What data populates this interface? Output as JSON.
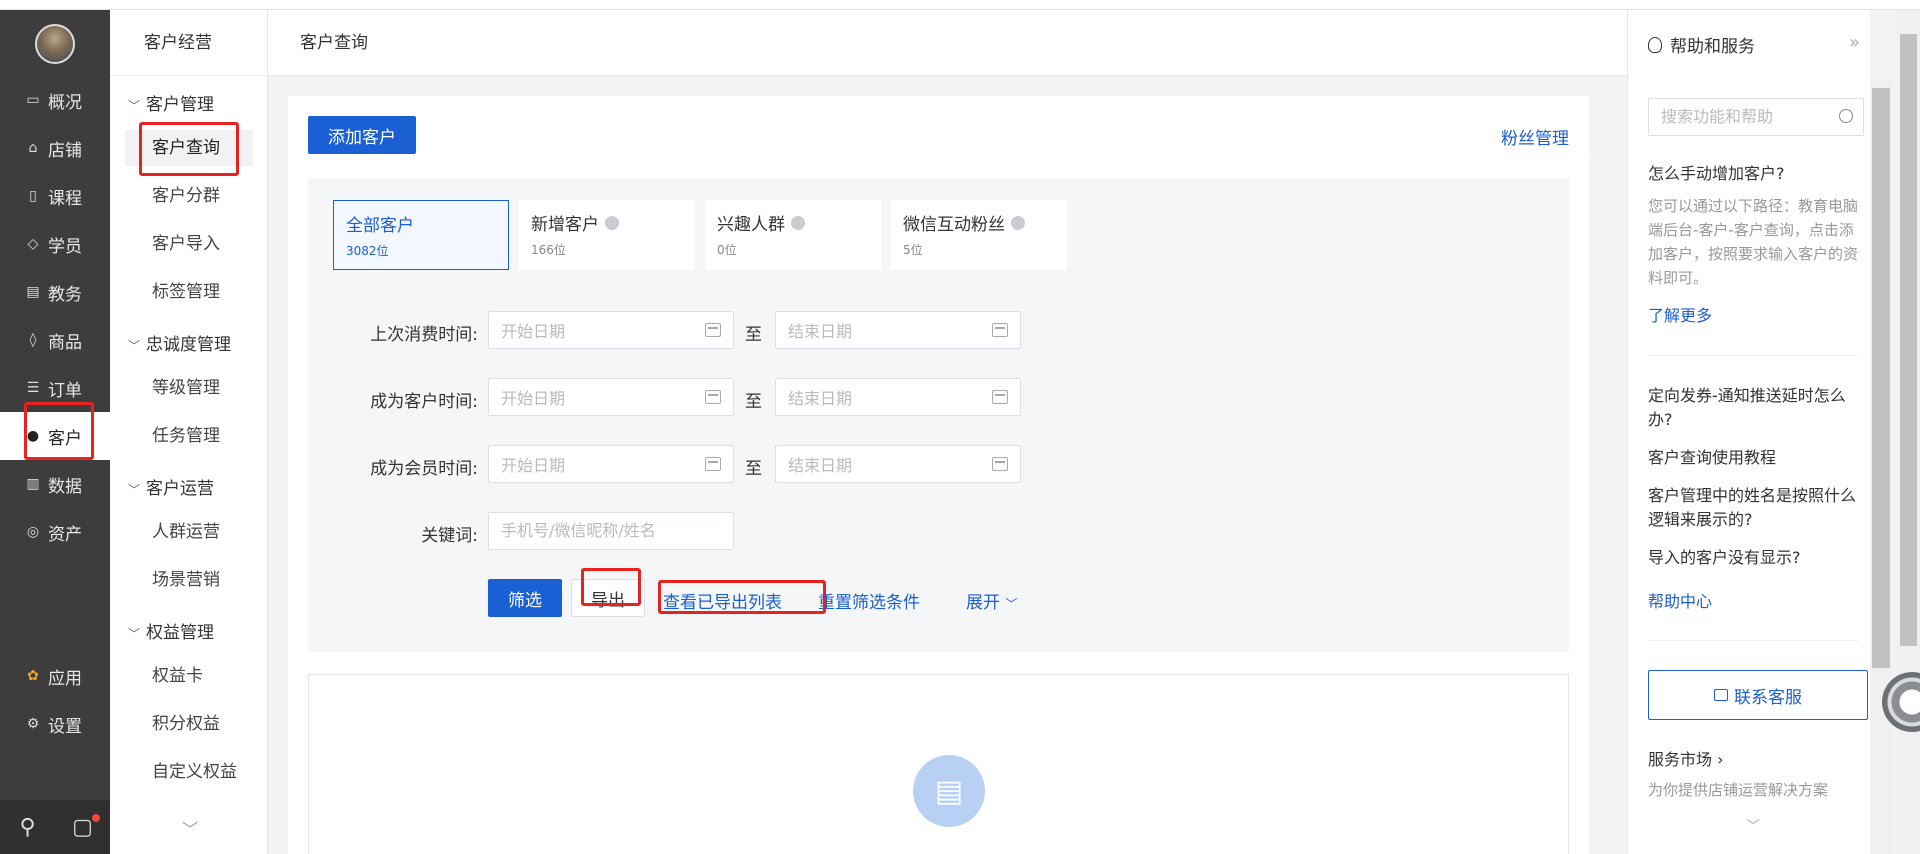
{
  "leftnav": {
    "items": [
      {
        "label": "概况",
        "icon": "monitor-icon"
      },
      {
        "label": "店铺",
        "icon": "store-icon"
      },
      {
        "label": "课程",
        "icon": "book-icon"
      },
      {
        "label": "学员",
        "icon": "graduation-cap-icon"
      },
      {
        "label": "教务",
        "icon": "calendar-icon"
      },
      {
        "label": "商品",
        "icon": "tag-icon"
      },
      {
        "label": "订单",
        "icon": "list-icon"
      },
      {
        "label": "客户",
        "icon": "user-icon"
      },
      {
        "label": "数据",
        "icon": "bar-chart-icon"
      },
      {
        "label": "资产",
        "icon": "coin-icon"
      }
    ],
    "bottom_items": [
      {
        "label": "应用",
        "icon": "apps-icon"
      },
      {
        "label": "设置",
        "icon": "gear-icon"
      }
    ]
  },
  "subnav": {
    "title": "客户经营",
    "groups": [
      {
        "label": "客户管理",
        "items": [
          "客户查询",
          "客户分群",
          "客户导入",
          "标签管理"
        ]
      },
      {
        "label": "忠诚度管理",
        "items": [
          "等级管理",
          "任务管理"
        ]
      },
      {
        "label": "客户运营",
        "items": [
          "人群运营",
          "场景营销"
        ]
      },
      {
        "label": "权益管理",
        "items": [
          "权益卡",
          "积分权益",
          "自定义权益"
        ]
      }
    ]
  },
  "page": {
    "title": "客户查询"
  },
  "main": {
    "add_button": "添加客户",
    "fans_link": "粉丝管理",
    "segments": [
      {
        "name": "全部客户",
        "count": "3082位"
      },
      {
        "name": "新增客户",
        "count": "166位"
      },
      {
        "name": "兴趣人群",
        "count": "0位"
      },
      {
        "name": "微信互动粉丝",
        "count": "5位"
      }
    ],
    "filters": {
      "last_purchase_label": "上次消费时间:",
      "became_customer_label": "成为客户时间:",
      "became_member_label": "成为会员时间:",
      "keyword_label": "关键词:",
      "start_placeholder": "开始日期",
      "end_placeholder": "结束日期",
      "to_label": "至",
      "keyword_placeholder": "手机号/微信昵称/姓名"
    },
    "actions": {
      "filter": "筛选",
      "export": "导出",
      "view_exported": "查看已导出列表",
      "reset": "重置筛选条件",
      "expand": "展开"
    }
  },
  "help": {
    "title": "帮助和服务",
    "search_placeholder": "搜索功能和帮助",
    "q1": "怎么手动增加客户?",
    "a1": "您可以通过以下路径：教育电脑端后台-客户-客户查询，点击添加客户，按照要求输入客户的资料即可。",
    "learn_more": "了解更多",
    "faq": [
      "定向发券-通知推送延时怎么办?",
      "客户查询使用教程",
      "客户管理中的姓名是按照什么逻辑来展示的?",
      "导入的客户没有显示?"
    ],
    "help_center": "帮助中心",
    "contact": "联系客服",
    "market_title": "服务市场",
    "market_sub": "为你提供店铺运营解决方案"
  },
  "colors": {
    "accent": "#1b5fd4",
    "nav_bg": "#3d3d3d",
    "highlight": "#e8231f"
  }
}
